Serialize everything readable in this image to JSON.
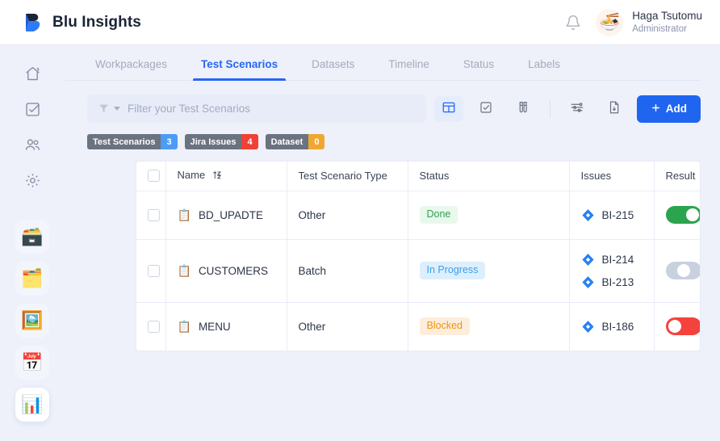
{
  "app": {
    "brand": "Blu Insights",
    "logo_color": "#2667f5"
  },
  "header": {
    "bell_icon": "bell-icon",
    "user_name": "Haga Tsutomu",
    "user_role": "Administrator",
    "avatar_glyph": "🍜"
  },
  "sidebar": {
    "top_items": [
      {
        "name": "home",
        "icon": "home-icon"
      },
      {
        "name": "tasks",
        "icon": "check-square-icon"
      },
      {
        "name": "users",
        "icon": "users-icon"
      },
      {
        "name": "settings",
        "icon": "gear-icon"
      }
    ],
    "project_items": [
      {
        "name": "card-index",
        "glyph": "🗃️",
        "active": false
      },
      {
        "name": "sticky-notes",
        "glyph": "🗂️",
        "active": false
      },
      {
        "name": "framed-picture",
        "glyph": "🖼️",
        "active": false
      },
      {
        "name": "calendar",
        "glyph": "📅",
        "active": false
      },
      {
        "name": "bar-chart",
        "glyph": "📊",
        "active": true
      }
    ]
  },
  "tabs": [
    {
      "label": "Workpackages",
      "active": false
    },
    {
      "label": "Test Scenarios",
      "active": true
    },
    {
      "label": "Datasets",
      "active": false
    },
    {
      "label": "Timeline",
      "active": false
    },
    {
      "label": "Status",
      "active": false
    },
    {
      "label": "Labels",
      "active": false
    }
  ],
  "toolbar": {
    "filter_placeholder": "Filter your Test Scenarios",
    "filter_value": "",
    "filter_icon": "funnel-icon",
    "buttons": [
      {
        "name": "table-view-button",
        "icon": "table-icon",
        "active": true
      },
      {
        "name": "checklist-view-button",
        "icon": "check-square-icon",
        "active": false
      },
      {
        "name": "test-tubes-button",
        "icon": "test-tubes-icon",
        "active": false
      },
      {
        "name": "settings-sliders-button",
        "icon": "sliders-icon",
        "active": false
      },
      {
        "name": "export-file-button",
        "icon": "file-download-icon",
        "active": false
      }
    ],
    "add_label": "Add",
    "add_icon": "plus-icon",
    "add_color": "#1f65f0"
  },
  "chips": [
    {
      "label": "Test Scenarios",
      "count": "3",
      "color": "#4a9cf6"
    },
    {
      "label": "Jira Issues",
      "count": "4",
      "color": "#ef4136"
    },
    {
      "label": "Dataset",
      "count": "0",
      "color": "#f0a732"
    }
  ],
  "table": {
    "columns": [
      "Name",
      "Test Scenario Type",
      "Status",
      "Issues",
      "Result"
    ],
    "sort_column": "Name",
    "sort_icon": "sort-az-icon",
    "rows": [
      {
        "name": "BD_UPADTE",
        "name_icon": "clipboard-icon",
        "type": "Other",
        "status": "Done",
        "status_style": "done",
        "issues": [
          "BI-215"
        ],
        "result": "pass",
        "checked": false
      },
      {
        "name": "CUSTOMERS",
        "name_icon": "clipboard-icon",
        "type": "Batch",
        "status": "In Progress",
        "status_style": "progress",
        "issues": [
          "BI-214",
          "BI-213"
        ],
        "result": "none",
        "checked": false
      },
      {
        "name": "MENU",
        "name_icon": "clipboard-icon",
        "type": "Other",
        "status": "Blocked",
        "status_style": "blocked",
        "issues": [
          "BI-186"
        ],
        "result": "fail",
        "checked": false
      }
    ]
  }
}
